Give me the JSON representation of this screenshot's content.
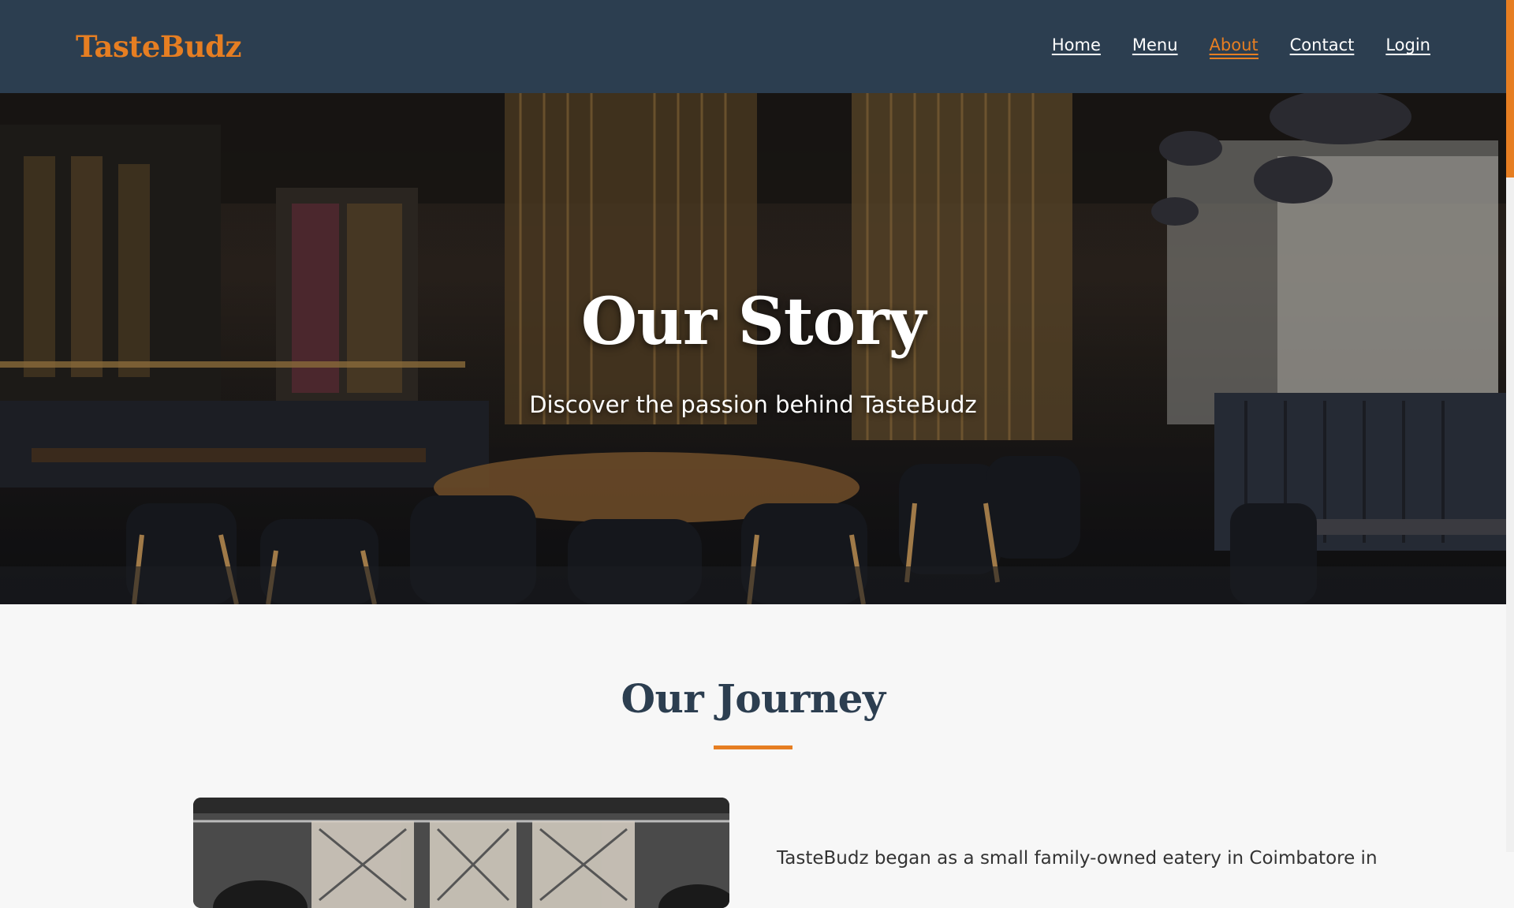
{
  "header": {
    "brand": "TasteBudz",
    "nav": [
      {
        "label": "Home",
        "active": false
      },
      {
        "label": "Menu",
        "active": false
      },
      {
        "label": "About",
        "active": true
      },
      {
        "label": "Contact",
        "active": false
      },
      {
        "label": "Login",
        "active": false
      }
    ]
  },
  "hero": {
    "title": "Our Story",
    "subtitle": "Discover the passion behind TasteBudz"
  },
  "journey": {
    "title": "Our Journey",
    "paragraph": "TasteBudz began as a small family-owned eatery in Coimbatore in"
  },
  "colors": {
    "header_bg": "#2c3e50",
    "accent": "#e67e22",
    "page_bg": "#f7f7f7",
    "heading": "#2c3e50"
  }
}
